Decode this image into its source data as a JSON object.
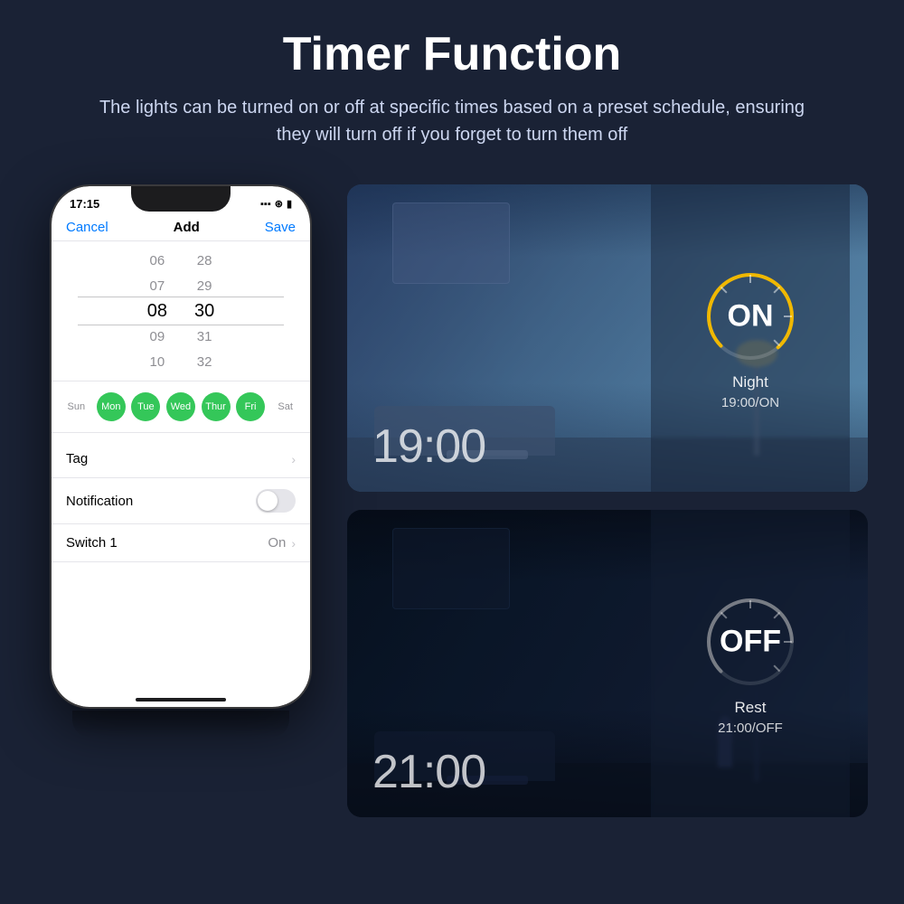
{
  "header": {
    "title": "Timer Function",
    "subtitle": "The lights can be turned on or off at specific times based on a preset schedule, ensuring they will turn off if you forget to turn them off"
  },
  "phone": {
    "status_time": "17:15",
    "nav": {
      "cancel": "Cancel",
      "add": "Add",
      "save": "Save"
    },
    "time_picker": {
      "hours": [
        "06",
        "07",
        "08",
        "09",
        "10"
      ],
      "minutes": [
        "28",
        "29",
        "30",
        "31",
        "32"
      ],
      "selected_hour": "08",
      "selected_minute": "30"
    },
    "days": [
      {
        "label": "Sun",
        "active": false
      },
      {
        "label": "Mon",
        "active": true
      },
      {
        "label": "Tue",
        "active": true
      },
      {
        "label": "Wed",
        "active": true
      },
      {
        "label": "Thur",
        "active": true
      },
      {
        "label": "Fri",
        "active": true
      },
      {
        "label": "Sat",
        "active": false
      }
    ],
    "settings": [
      {
        "label": "Tag",
        "type": "arrow",
        "value": ""
      },
      {
        "label": "Notification",
        "type": "toggle",
        "value": "off"
      },
      {
        "label": "Switch 1",
        "type": "arrow",
        "value": "On"
      }
    ]
  },
  "panel_on": {
    "time": "19:00",
    "status": "ON",
    "label": "Night",
    "schedule": "19:00/ON",
    "dial_color": "#f0b800"
  },
  "panel_off": {
    "time": "21:00",
    "status": "OFF",
    "label": "Rest",
    "schedule": "21:00/OFF",
    "dial_color": "#888"
  }
}
